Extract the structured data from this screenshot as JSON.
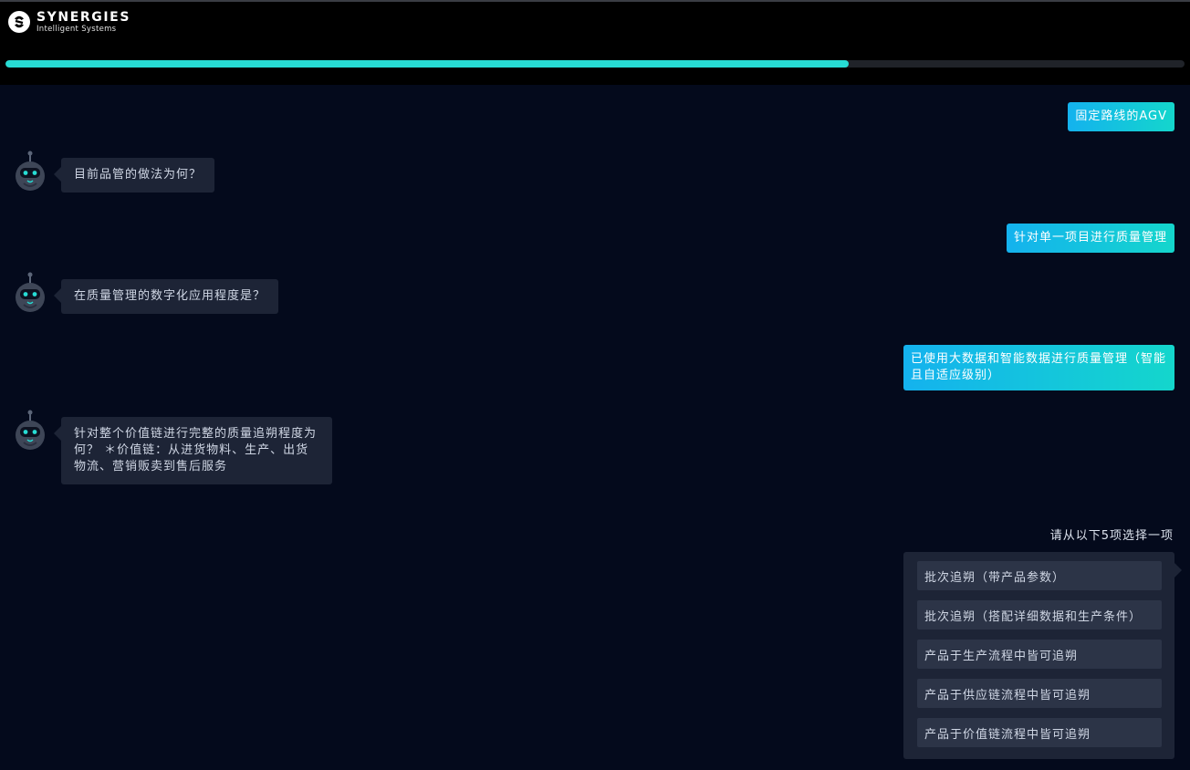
{
  "brand": {
    "title": "SYNERGIES",
    "subtitle": "Intelligent Systems"
  },
  "progress": {
    "fraction": 0.715,
    "color": "#27dcd4"
  },
  "colors": {
    "background": "#040a1c",
    "bot_bubble": "#1d2436",
    "user_gradient_start": "#14b2ee",
    "user_gradient_end": "#14d6cc"
  },
  "conversation": {
    "user_1": "固定路线的AGV",
    "bot_1": "目前品管的做法为何？",
    "user_2": "针对单一项目进行质量管理",
    "bot_2": "在质量管理的数字化应用程度是？",
    "user_3": "已使用大数据和智能数据进行质量管理（智能且自适应级别）",
    "bot_3": "针对整个价值链进行完整的质量追朔程度为何？ ＊价值链：从进货物料、生产、出货物流、营销贩卖到售后服务"
  },
  "selection": {
    "prompt": "请从以下5项选择一项",
    "options": [
      "批次追朔（带产品参数）",
      "批次追朔（搭配详细数据和生产条件）",
      "产品于生产流程中皆可追朔",
      "产品于供应链流程中皆可追朔",
      "产品于价值链流程中皆可追朔"
    ]
  },
  "icons": {
    "logo": "synergies-logo-icon",
    "bot": "robot-avatar-icon"
  }
}
